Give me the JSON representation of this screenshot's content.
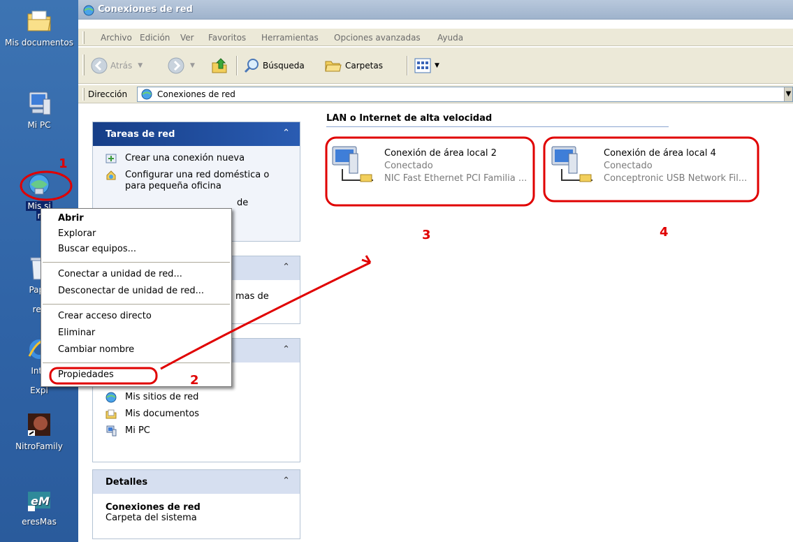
{
  "desktop": {
    "icons": [
      {
        "label": "Mis documentos",
        "icon": "my-documents-icon"
      },
      {
        "label": "Mi PC",
        "icon": "my-computer-icon"
      },
      {
        "label": "Mis si",
        "icon": "network-places-icon"
      },
      {
        "label": "r",
        "icon": ""
      },
      {
        "label": "Pape",
        "icon": "recycle-bin-icon"
      },
      {
        "label": "rec",
        "icon": ""
      },
      {
        "label": "Inte",
        "icon": "internet-explorer-icon"
      },
      {
        "label": "Expl",
        "icon": ""
      },
      {
        "label": "NitroFamily",
        "icon": "nitrofamily-icon"
      },
      {
        "label": "eresMas",
        "icon": "eresmas-icon"
      }
    ]
  },
  "window": {
    "title": "Conexiones de red",
    "menu": [
      "Archivo",
      "Edición",
      "Ver",
      "Favoritos",
      "Herramientas",
      "Opciones avanzadas",
      "Ayuda"
    ],
    "toolbar": {
      "back": "Atrás",
      "search": "Búsqueda",
      "folders": "Carpetas"
    },
    "address": {
      "label": "Dirección",
      "value": "Conexiones de red"
    }
  },
  "taskpane": {
    "network_tasks": {
      "title": "Tareas de red",
      "items": [
        "Crear una conexión nueva",
        "Configurar una red doméstica o para pequeña oficina",
        "de"
      ]
    },
    "panel2": {
      "partial": "mas de"
    },
    "other_places": {
      "items": [
        "Mis sitios de red",
        "Mis documentos",
        "Mi PC"
      ]
    },
    "details": {
      "title": "Detalles",
      "name": "Conexiones de red",
      "desc": "Carpeta del sistema"
    }
  },
  "content": {
    "group_header": "LAN o Internet de alta velocidad",
    "connections": [
      {
        "name": "Conexión de área local 2",
        "status": "Conectado",
        "device": "NIC Fast Ethernet PCI Familia ..."
      },
      {
        "name": "Conexión de área local 4",
        "status": "Conectado",
        "device": "Conceptronic USB Network Fil..."
      }
    ]
  },
  "context_menu": {
    "items": [
      "Abrir",
      "Explorar",
      "Buscar equipos...",
      "Conectar a unidad de red...",
      "Desconectar de unidad de red...",
      "Crear acceso directo",
      "Eliminar",
      "Cambiar nombre",
      "Propiedades"
    ]
  },
  "annotations": {
    "n1": "1",
    "n2": "2",
    "n3": "3",
    "n4": "4",
    "color": "#e00000"
  }
}
